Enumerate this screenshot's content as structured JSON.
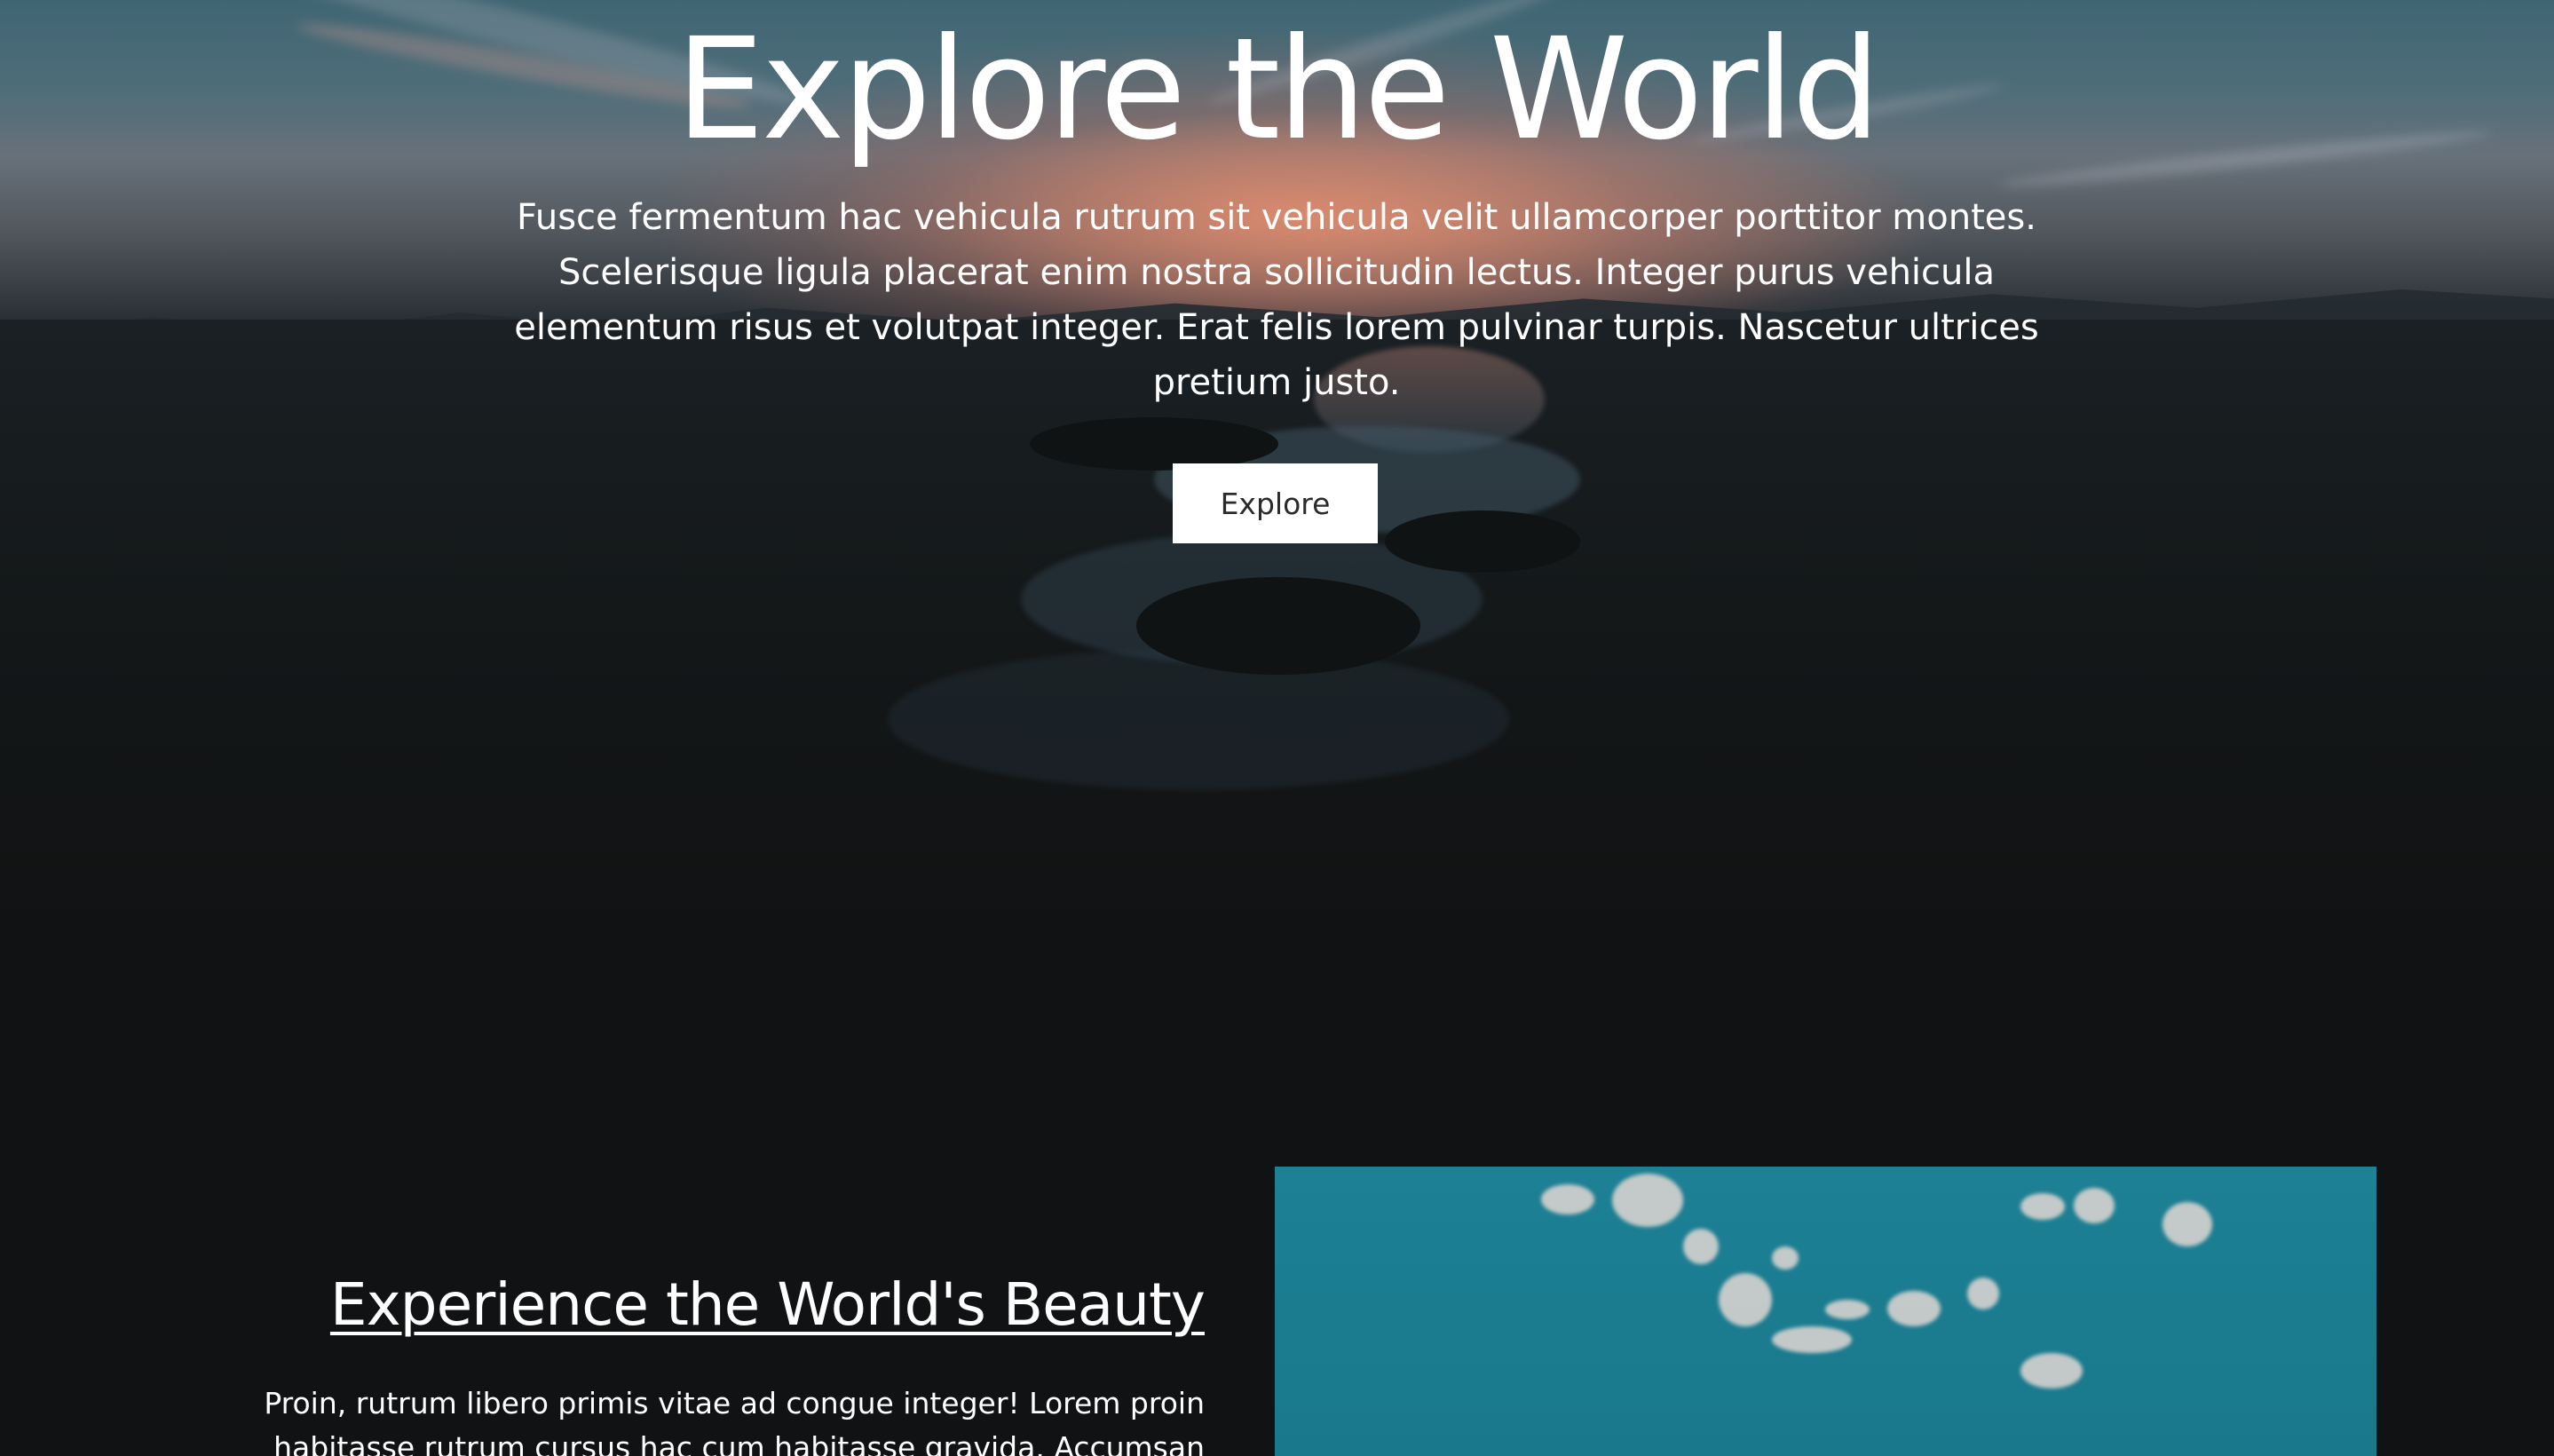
{
  "hero": {
    "title": "Explore the World",
    "description": "Fusce fermentum hac vehicula rutrum sit vehicula velit ullamcorper porttitor montes. Scelerisque ligula placerat enim nostra sollicitudin lectus. Integer purus vehicula elementum risus et volutpat integer. Erat felis lorem pulvinar turpis. Nascetur ultrices pretium justo.",
    "button_label": "Explore"
  },
  "section": {
    "heading": "Experience the World's Beauty",
    "text": "Proin, rutrum libero primis vitae ad congue integer! Lorem proin habitasse rutrum cursus hac cum habitasse gravida. Accumsan ultricies"
  },
  "colors": {
    "page_background": "#111213",
    "button_background": "#ffffff",
    "button_text": "#2a2a2a",
    "text": "#ffffff",
    "sky_image": "#1e8094"
  }
}
